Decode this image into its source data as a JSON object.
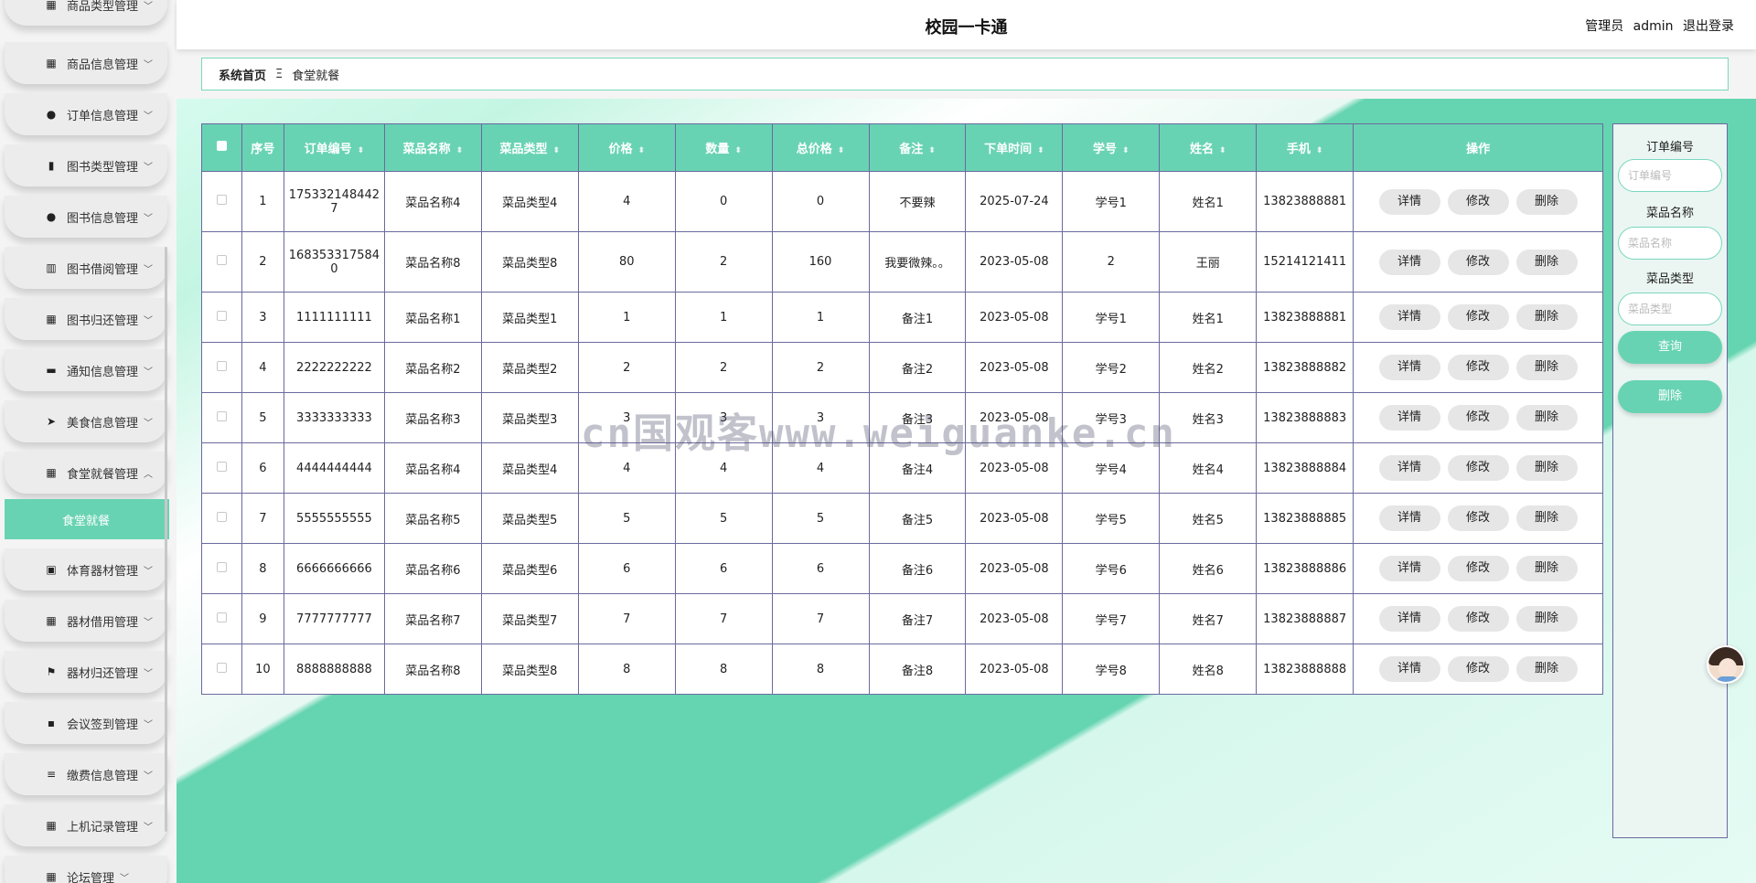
{
  "app_title": "校园一卡通",
  "header": {
    "role": "管理员",
    "username": "admin",
    "logout": "退出登录"
  },
  "breadcrumb": {
    "home": "系统首页",
    "separator": "Ξ",
    "current": "食堂就餐"
  },
  "sidebar": {
    "items": [
      {
        "label": "商品类型管理",
        "icon": "grid-icon"
      },
      {
        "label": "商品信息管理",
        "icon": "grid-icon"
      },
      {
        "label": "订单信息管理",
        "icon": "user-icon"
      },
      {
        "label": "图书类型管理",
        "icon": "bar-chart-icon"
      },
      {
        "label": "图书信息管理",
        "icon": "bulb-icon"
      },
      {
        "label": "图书借阅管理",
        "icon": "book-icon"
      },
      {
        "label": "图书归还管理",
        "icon": "grid-icon"
      },
      {
        "label": "通知信息管理",
        "icon": "sign-icon"
      },
      {
        "label": "美食信息管理",
        "icon": "send-icon"
      },
      {
        "label": "食堂就餐管理",
        "icon": "grid-icon",
        "expanded": true
      },
      {
        "label": "体育器材管理",
        "icon": "clipboard-icon"
      },
      {
        "label": "器材借用管理",
        "icon": "apps-icon"
      },
      {
        "label": "器材归还管理",
        "icon": "flag-icon"
      },
      {
        "label": "会议签到管理",
        "icon": "chat-icon"
      },
      {
        "label": "缴费信息管理",
        "icon": "list-icon"
      },
      {
        "label": "上机记录管理",
        "icon": "grid-icon"
      },
      {
        "label": "论坛管理",
        "icon": "grid-icon"
      }
    ],
    "active_sub": "食堂就餐"
  },
  "table": {
    "columns": [
      "序号",
      "订单编号",
      "菜品名称",
      "菜品类型",
      "价格",
      "数量",
      "总价格",
      "备注",
      "下单时间",
      "学号",
      "姓名",
      "手机",
      "操作"
    ],
    "actions": [
      "详情",
      "修改",
      "删除"
    ],
    "rows": [
      {
        "no": "1",
        "order": "175332148442",
        "order2": "7",
        "dish": "菜品名称4",
        "type": "菜品类型4",
        "price": "4",
        "qty": "0",
        "total": "0",
        "note": "不要辣",
        "time": "2025-07-24",
        "sid": "学号1",
        "name": "姓名1",
        "phone": "13823888881"
      },
      {
        "no": "2",
        "order": "168353317584",
        "order2": "0",
        "dish": "菜品名称8",
        "type": "菜品类型8",
        "price": "80",
        "qty": "2",
        "total": "160",
        "note": "我要微辣。。",
        "time": "2023-05-08",
        "sid": "2",
        "name": "王丽",
        "phone": "15214121411"
      },
      {
        "no": "3",
        "order": "1111111111",
        "order2": "",
        "dish": "菜品名称1",
        "type": "菜品类型1",
        "price": "1",
        "qty": "1",
        "total": "1",
        "note": "备注1",
        "time": "2023-05-08",
        "sid": "学号1",
        "name": "姓名1",
        "phone": "13823888881"
      },
      {
        "no": "4",
        "order": "2222222222",
        "order2": "",
        "dish": "菜品名称2",
        "type": "菜品类型2",
        "price": "2",
        "qty": "2",
        "total": "2",
        "note": "备注2",
        "time": "2023-05-08",
        "sid": "学号2",
        "name": "姓名2",
        "phone": "13823888882"
      },
      {
        "no": "5",
        "order": "3333333333",
        "order2": "",
        "dish": "菜品名称3",
        "type": "菜品类型3",
        "price": "3",
        "qty": "3",
        "total": "3",
        "note": "备注3",
        "time": "2023-05-08",
        "sid": "学号3",
        "name": "姓名3",
        "phone": "13823888883"
      },
      {
        "no": "6",
        "order": "4444444444",
        "order2": "",
        "dish": "菜品名称4",
        "type": "菜品类型4",
        "price": "4",
        "qty": "4",
        "total": "4",
        "note": "备注4",
        "time": "2023-05-08",
        "sid": "学号4",
        "name": "姓名4",
        "phone": "13823888884"
      },
      {
        "no": "7",
        "order": "5555555555",
        "order2": "",
        "dish": "菜品名称5",
        "type": "菜品类型5",
        "price": "5",
        "qty": "5",
        "total": "5",
        "note": "备注5",
        "time": "2023-05-08",
        "sid": "学号5",
        "name": "姓名5",
        "phone": "13823888885"
      },
      {
        "no": "8",
        "order": "6666666666",
        "order2": "",
        "dish": "菜品名称6",
        "type": "菜品类型6",
        "price": "6",
        "qty": "6",
        "total": "6",
        "note": "备注6",
        "time": "2023-05-08",
        "sid": "学号6",
        "name": "姓名6",
        "phone": "13823888886"
      },
      {
        "no": "9",
        "order": "7777777777",
        "order2": "",
        "dish": "菜品名称7",
        "type": "菜品类型7",
        "price": "7",
        "qty": "7",
        "total": "7",
        "note": "备注7",
        "time": "2023-05-08",
        "sid": "学号7",
        "name": "姓名7",
        "phone": "13823888887"
      },
      {
        "no": "10",
        "order": "8888888888",
        "order2": "",
        "dish": "菜品名称8",
        "type": "菜品类型8",
        "price": "8",
        "qty": "8",
        "total": "8",
        "note": "备注8",
        "time": "2023-05-08",
        "sid": "学号8",
        "name": "姓名8",
        "phone": "13823888888"
      }
    ]
  },
  "search": {
    "order_label": "订单编号",
    "order_placeholder": "订单编号",
    "dish_label": "菜品名称",
    "dish_placeholder": "菜品名称",
    "type_label": "菜品类型",
    "type_placeholder": "菜品类型",
    "query_btn": "查询",
    "delete_btn": "删除"
  },
  "watermark": "cn国观客www.weiguanke.cn",
  "colors": {
    "accent": "#68d3b3",
    "border": "#6a6a9e"
  }
}
